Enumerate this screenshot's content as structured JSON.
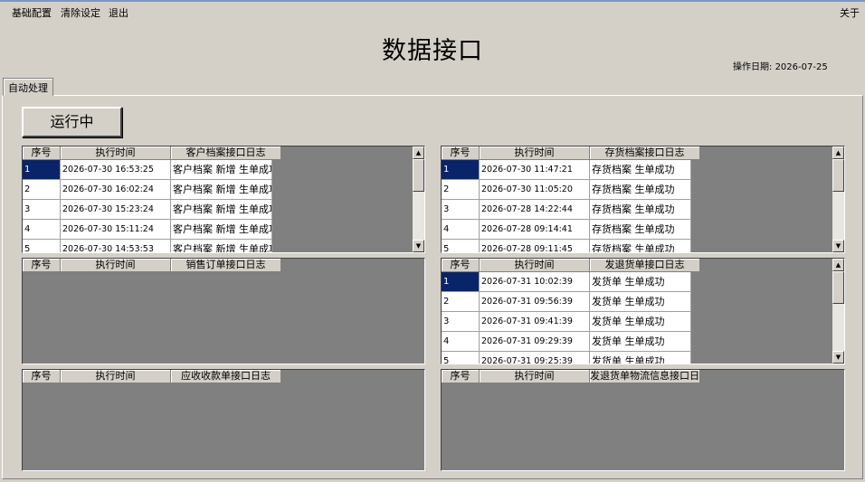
{
  "menu": {
    "items": [
      "基础配置",
      "清除设定",
      "退出"
    ],
    "about": "关于"
  },
  "title": "数据接口",
  "op_date": {
    "label": "操作日期:",
    "value": "2026-07-25"
  },
  "tab": "自动处理",
  "run_button": "运行中",
  "grids": [
    {
      "headers": [
        "序号",
        "执行时间",
        "客户档案接口日志"
      ],
      "rows": [
        [
          "1",
          "2026-07-30 16:53:25",
          "客户档案 新增 生单成功"
        ],
        [
          "2",
          "2026-07-30 16:02:24",
          "客户档案 新增 生单成功"
        ],
        [
          "3",
          "2026-07-30 15:23:24",
          "客户档案 新增 生单成功"
        ],
        [
          "4",
          "2026-07-30 15:11:24",
          "客户档案 新增 生单成功"
        ],
        [
          "5",
          "2026-07-30 14:53:53",
          "客户档案 新增 生单成功"
        ]
      ],
      "selected_row": 1,
      "scrollbar": true
    },
    {
      "headers": [
        "序号",
        "执行时间",
        "存货档案接口日志"
      ],
      "rows": [
        [
          "1",
          "2026-07-30 11:47:21",
          "存货档案 生单成功"
        ],
        [
          "2",
          "2026-07-30 11:05:20",
          "存货档案 生单成功"
        ],
        [
          "3",
          "2026-07-28 14:22:44",
          "存货档案 生单成功"
        ],
        [
          "4",
          "2026-07-28 09:14:41",
          "存货档案 生单成功"
        ],
        [
          "5",
          "2026-07-28 09:11:45",
          "存货档案 生单成功"
        ]
      ],
      "selected_row": 1,
      "scrollbar": true
    },
    {
      "headers": [
        "序号",
        "执行时间",
        "销售订单接口日志"
      ],
      "rows": [],
      "scrollbar": false
    },
    {
      "headers": [
        "序号",
        "执行时间",
        "发退货单接口日志"
      ],
      "rows": [
        [
          "1",
          "2026-07-31 10:02:39",
          "发货单 生单成功"
        ],
        [
          "2",
          "2026-07-31 09:56:39",
          "发货单 生单成功"
        ],
        [
          "3",
          "2026-07-31 09:41:39",
          "发货单 生单成功"
        ],
        [
          "4",
          "2026-07-31 09:29:39",
          "发货单 生单成功"
        ],
        [
          "5",
          "2026-07-31 09:25:39",
          "发货单 生单成功"
        ]
      ],
      "selected_row": 1,
      "scrollbar": true
    },
    {
      "headers": [
        "序号",
        "执行时间",
        "应收收款单接口日志"
      ],
      "rows": [],
      "scrollbar": false
    },
    {
      "headers": [
        "序号",
        "执行时间",
        "发退货单物流信息接口日志"
      ],
      "rows": [],
      "scrollbar": false
    }
  ]
}
